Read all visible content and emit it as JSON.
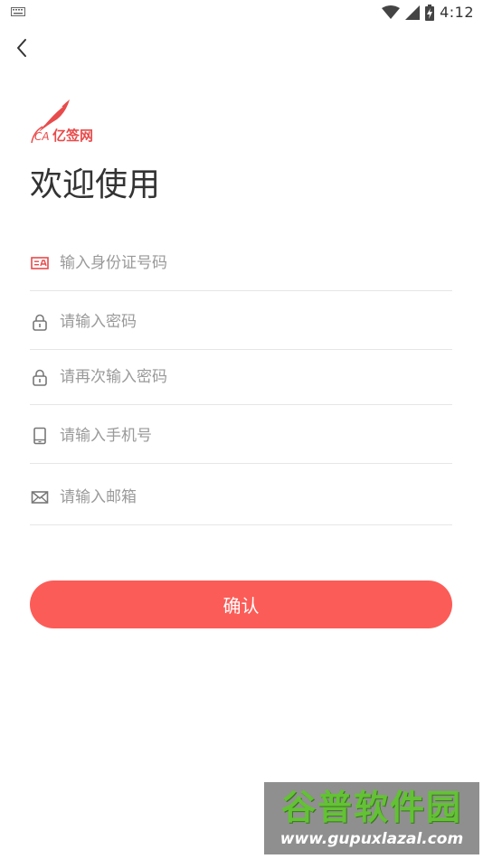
{
  "status_bar": {
    "time": "4:12",
    "icons": [
      "keyboard-icon",
      "wifi-icon",
      "signal-icon",
      "battery-charging-icon"
    ]
  },
  "nav": {
    "back_icon": "chevron-left-icon"
  },
  "logo": {
    "ca": "CA",
    "text": "亿签网"
  },
  "title": "欢迎使用",
  "form": {
    "id_placeholder": "输入身份证号码",
    "password_placeholder": "请输入密码",
    "password_confirm_placeholder": "请再次输入密码",
    "phone_placeholder": "请输入手机号",
    "email_placeholder": "请输入邮箱"
  },
  "confirm_button": "确认",
  "watermark": {
    "title": "谷普软件园",
    "url": "www.gupuxlazal.com"
  },
  "colors": {
    "accent": "#fc5c57",
    "icon_red": "#e84b4b",
    "divider": "#e6e6e6",
    "placeholder": "#9a9a9a"
  }
}
